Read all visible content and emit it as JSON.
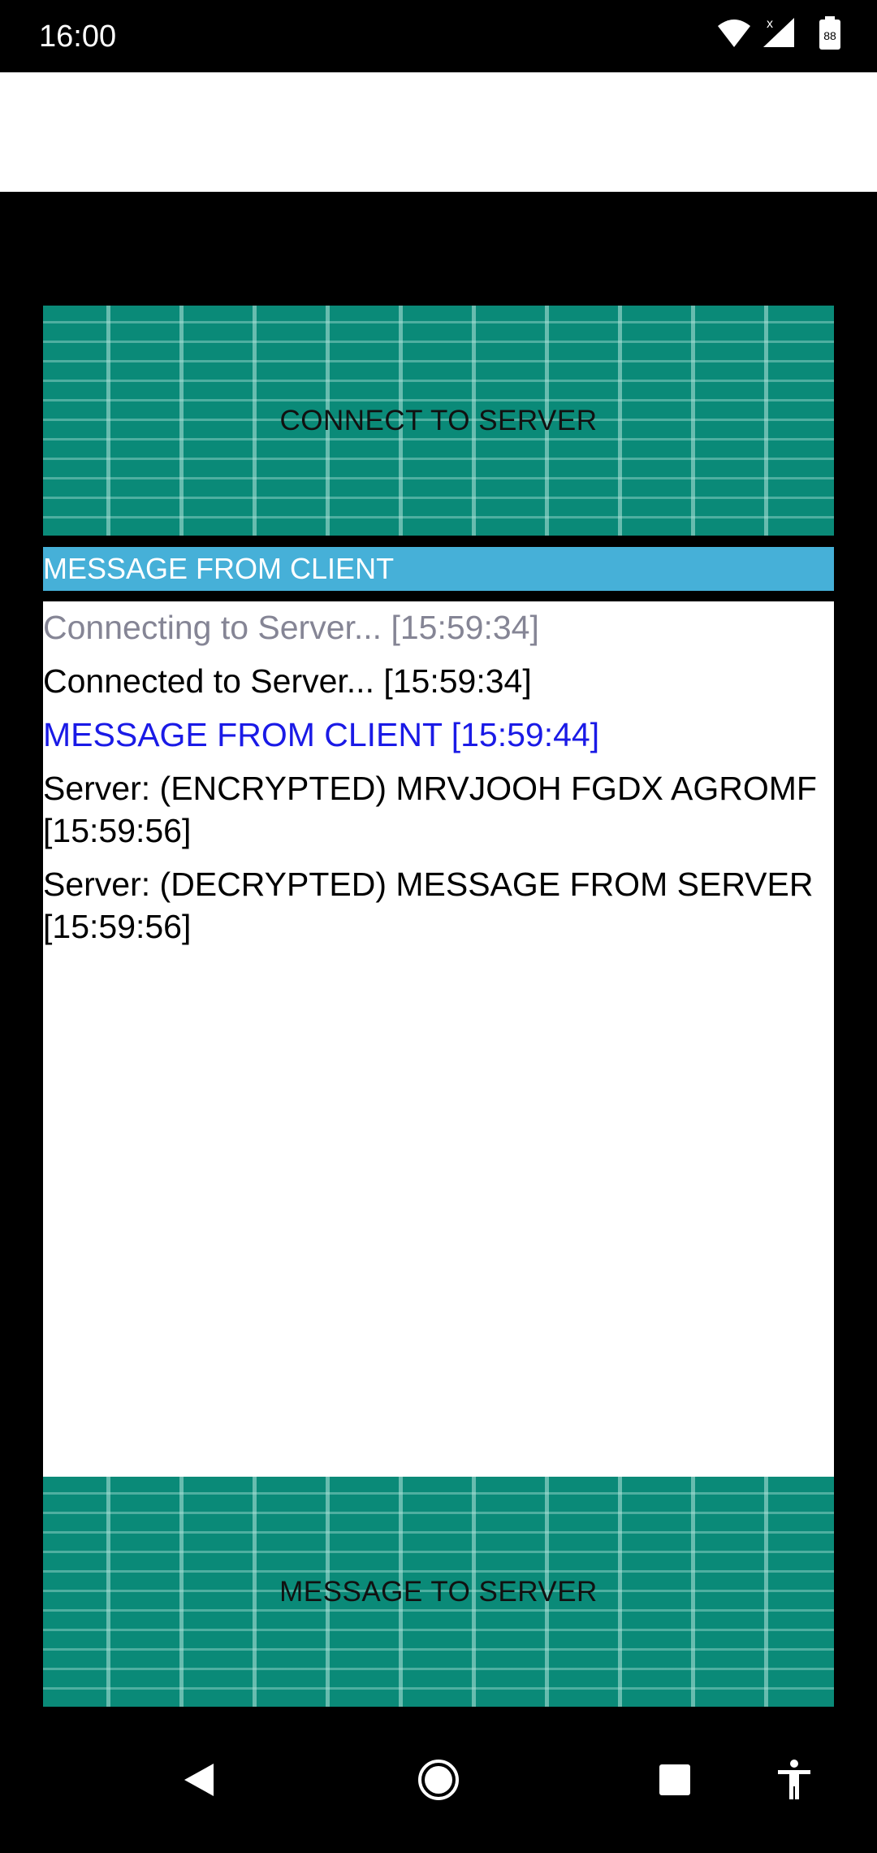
{
  "status_bar": {
    "time": "16:00",
    "battery": "88",
    "icons": [
      "wifi-icon",
      "signal-icon",
      "battery-icon"
    ]
  },
  "buttons": {
    "connect_label": "CONNECT TO SERVER",
    "send_label": "MESSAGE TO SERVER"
  },
  "message_input": {
    "value": "MESSAGE FROM CLIENT"
  },
  "log": [
    {
      "text": "Connecting to Server... [15:59:34]",
      "kind": "pending"
    },
    {
      "text": "Connected to Server... [15:59:34]",
      "kind": "normal"
    },
    {
      "text": "MESSAGE FROM CLIENT [15:59:44]",
      "kind": "client"
    },
    {
      "text": "Server: (ENCRYPTED)  MRVJOOH FGDX AGROMF [15:59:56]",
      "kind": "normal"
    },
    {
      "text": "Server: (DECRYPTED)  MESSAGE FROM SERVER [15:59:56]",
      "kind": "normal"
    }
  ],
  "nav_bar": {
    "icons": [
      "back-icon",
      "home-icon",
      "recents-icon",
      "accessibility-icon"
    ]
  },
  "colors": {
    "button_teal": "#0a8a78",
    "input_blue": "#46b0d8",
    "pending_gray": "#858595",
    "client_blue": "#1a1ae6"
  }
}
